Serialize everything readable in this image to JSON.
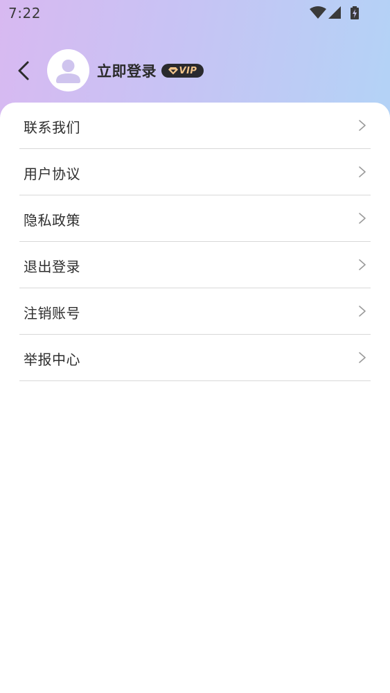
{
  "status_bar": {
    "time": "7:22",
    "icons": [
      "wifi-icon",
      "signal-icon",
      "battery-charging-icon"
    ]
  },
  "header": {
    "back_icon": "chevron-left-icon",
    "avatar_icon": "user-icon",
    "login_label": "立即登录",
    "vip_badge": "VIP"
  },
  "colors": {
    "gradient_start": "#d8b9f1",
    "gradient_end": "#b3d3f6",
    "vip_background": "#2a2a2e",
    "vip_text": "#f2c48a"
  },
  "menu": {
    "items": [
      {
        "label": "联系我们"
      },
      {
        "label": "用户协议"
      },
      {
        "label": "隐私政策"
      },
      {
        "label": "退出登录"
      },
      {
        "label": "注销账号"
      },
      {
        "label": "举报中心"
      }
    ]
  }
}
